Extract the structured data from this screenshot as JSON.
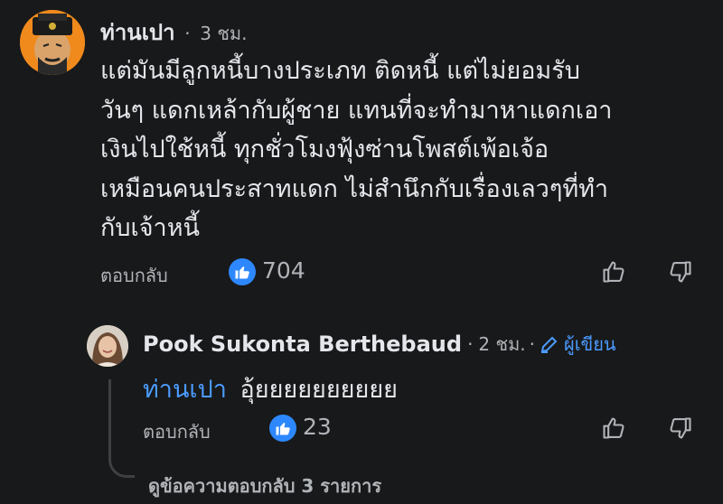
{
  "comment": {
    "author": "ท่านเปา",
    "separator": "·",
    "time": "3 ชม.",
    "lines": [
      "แต่มันมีลูกหนี้บางประเภท ติดหนี้ แต่ไม่ยอมรับ",
      "วันๆ แดกเหล้ากับผู้ชาย แทนที่จะทำมาหาแดกเอา",
      "เงินไปใช้หนี้ ทุกชั่วโมงฟุ้งซ่านโพสต์เพ้อเจ้อ",
      "เหมือนคนประสาทแดก ไม่สำนึกกับเรื่องเลวๆที่ทำ",
      "กับเจ้าหนี้"
    ],
    "reply_label": "ตอบกลับ",
    "like_count": "704"
  },
  "reply": {
    "author": "Pook Sukonta Berthebaud",
    "separator": "·",
    "time": "2 ชม.",
    "author_badge": "ผู้เขียน",
    "mention": "ท่านเปา",
    "text": "อุ้ยยยยยยยยยย",
    "reply_label": "ตอบกลับ",
    "like_count": "23"
  },
  "view_replies": "ดูข้อความตอบกลับ 3 รายการ",
  "colors": {
    "background": "#18191a",
    "text": "#e4e6eb",
    "secondary_text": "#b0b3b8",
    "accent_blue": "#2d88ff",
    "mention_blue": "#4b9bff"
  },
  "icons": [
    "like-thumb-icon",
    "thumbs-up-icon",
    "thumbs-down-icon",
    "pencil-icon"
  ]
}
